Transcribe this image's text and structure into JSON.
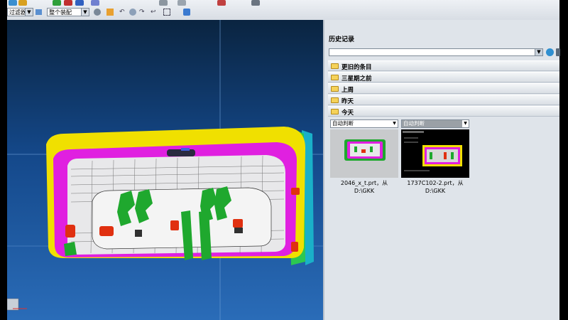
{
  "toolbar": {
    "filter_label": "过滤器",
    "assembly_label": "整个装配"
  },
  "history_panel": {
    "title": "历史记录",
    "groups": [
      {
        "label": "更旧的条目"
      },
      {
        "label": "三星期之前"
      },
      {
        "label": "上周"
      },
      {
        "label": "昨天"
      },
      {
        "label": "今天"
      }
    ],
    "items": [
      {
        "dropdown": "自动判断",
        "caption_line1": "2046_x_t.prt，从 D:\\GKK",
        "caption_line2": ""
      },
      {
        "dropdown": "自动判断",
        "caption_line1": "1737C102-2.prt，从",
        "caption_line2": "D:\\GKK"
      }
    ]
  },
  "colors": {
    "viewport_top": "#0a2440",
    "viewport_bottom": "#2a6cb8",
    "panel_bg": "#dfe4ea",
    "mold_yellow": "#f0e000",
    "mold_magenta": "#e020e0",
    "mold_green": "#1fa82e",
    "mold_red": "#e03010"
  },
  "icons": [
    "undo-icon",
    "redo-icon",
    "select-icon",
    "view-icon",
    "folder-icon",
    "go-icon",
    "globe-icon"
  ]
}
